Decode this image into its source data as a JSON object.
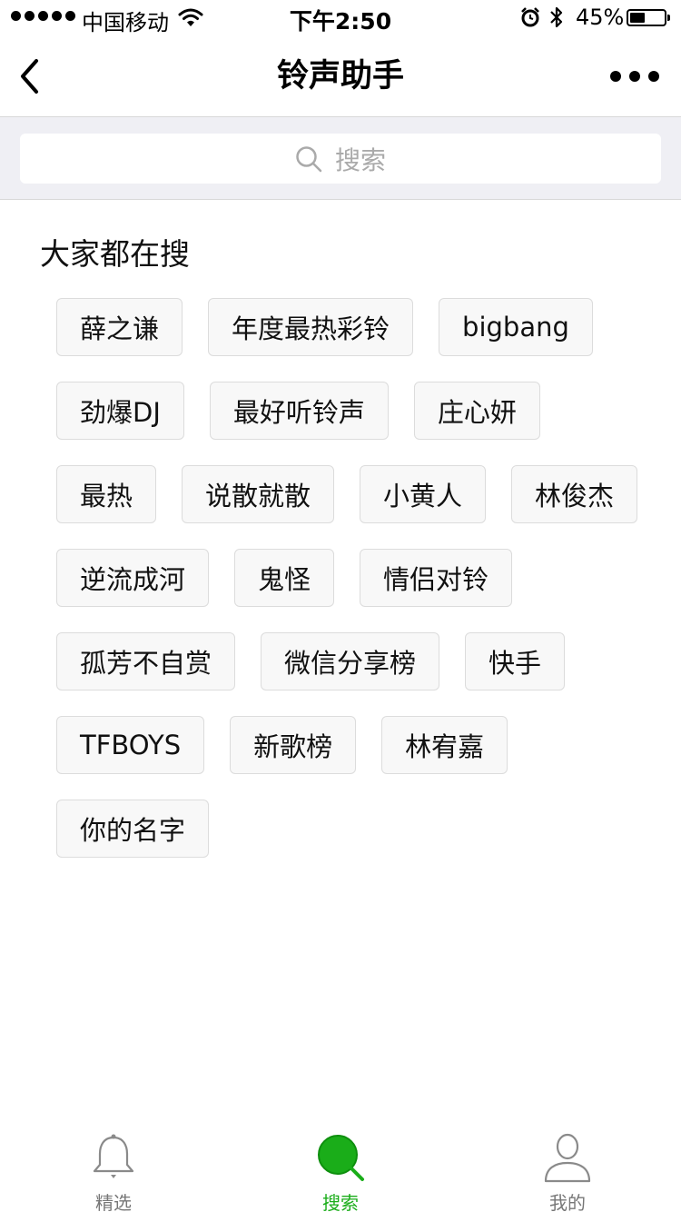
{
  "status_bar": {
    "carrier": "中国移动",
    "time": "下午2:50",
    "battery_percent_text": "45%",
    "battery_level": 0.45,
    "signal_bars": 5
  },
  "nav": {
    "title": "铃声助手",
    "back_icon": "chevron-left-icon",
    "more_icon": "more-dots-icon"
  },
  "search": {
    "placeholder": "搜索",
    "icon": "search-icon"
  },
  "hot": {
    "title": "大家都在搜",
    "tags": [
      "薛之谦",
      "年度最热彩铃",
      "bigbang",
      "劲爆DJ",
      "最好听铃声",
      "庄心妍",
      "最热",
      "说散就散",
      "小黄人",
      "林俊杰",
      "逆流成河",
      "鬼怪",
      "情侣对铃",
      "孤芳不自赏",
      "微信分享榜",
      "快手",
      "TFBOYS",
      "新歌榜",
      "林宥嘉",
      "你的名字"
    ]
  },
  "tabbar": {
    "items": [
      {
        "label": "精选",
        "icon": "bell-icon",
        "active": false
      },
      {
        "label": "搜索",
        "icon": "search-icon",
        "active": true
      },
      {
        "label": "我的",
        "icon": "user-icon",
        "active": false
      }
    ],
    "active_color": "#1aad19",
    "inactive_color": "#777777"
  }
}
